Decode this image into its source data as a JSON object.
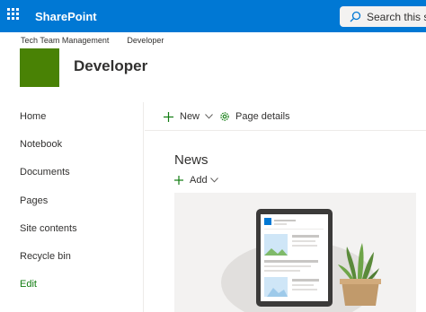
{
  "suite_bar": {
    "app_name": "SharePoint",
    "search_placeholder": "Search this site",
    "background_color": "#0078d4"
  },
  "breadcrumb": [
    "Tech Team Management",
    "Developer"
  ],
  "site": {
    "title": "Developer",
    "logo_color": "#498205"
  },
  "left_nav": {
    "items": [
      "Home",
      "Notebook",
      "Documents",
      "Pages",
      "Site contents",
      "Recycle bin"
    ],
    "edit_label": "Edit"
  },
  "command_bar": {
    "new_label": "New",
    "page_details_label": "Page details"
  },
  "news": {
    "title": "News",
    "add_label": "Add"
  },
  "icons": [
    "waffle-icon",
    "search-icon",
    "plus-icon",
    "chevron-down-icon",
    "gear-icon"
  ]
}
